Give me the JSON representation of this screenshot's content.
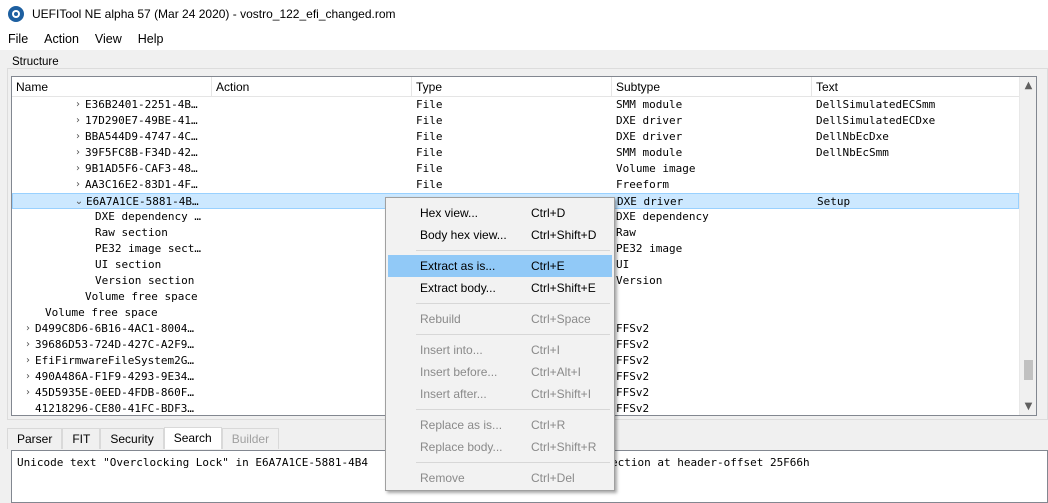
{
  "window": {
    "title": "UEFITool NE alpha 57 (Mar 24 2020) - vostro_122_efi_changed.rom"
  },
  "menubar": [
    "File",
    "Action",
    "View",
    "Help"
  ],
  "structure": {
    "label": "Structure",
    "columns": [
      "Name",
      "Action",
      "Type",
      "Subtype",
      "Text"
    ],
    "rows": [
      {
        "name": "E36B2401-2251-4B…",
        "type": "File",
        "subtype": "SMM module",
        "text": "DellSimulatedECSmm",
        "expander": "collapsed"
      },
      {
        "name": "17D290E7-49BE-41…",
        "type": "File",
        "subtype": "DXE driver",
        "text": "DellSimulatedECDxe",
        "expander": "collapsed"
      },
      {
        "name": "BBA544D9-4747-4C…",
        "type": "File",
        "subtype": "DXE driver",
        "text": "DellNbEcDxe",
        "expander": "collapsed"
      },
      {
        "name": "39F5FC8B-F34D-42…",
        "type": "File",
        "subtype": "SMM module",
        "text": "DellNbEcSmm",
        "expander": "collapsed"
      },
      {
        "name": "9B1AD5F6-CAF3-48…",
        "type": "File",
        "subtype": "Volume image",
        "text": "",
        "expander": "collapsed"
      },
      {
        "name": "AA3C16E2-83D1-4F…",
        "type": "File",
        "subtype": "Freeform",
        "text": "",
        "expander": "collapsed"
      },
      {
        "name": "E6A7A1CE-5881-4B…",
        "type": "",
        "subtype": "DXE driver",
        "text": "Setup",
        "expander": "expanded",
        "selected": true
      },
      {
        "name": "DXE dependency …",
        "type": "",
        "subtype": "DXE dependency",
        "text": "",
        "expander": "none"
      },
      {
        "name": "Raw section",
        "type": "",
        "subtype": "Raw",
        "text": "",
        "expander": "none"
      },
      {
        "name": "PE32 image sect…",
        "type": "",
        "subtype": "PE32 image",
        "text": "",
        "expander": "none"
      },
      {
        "name": "UI section",
        "type": "",
        "subtype": "UI",
        "text": "",
        "expander": "none"
      },
      {
        "name": "Version section",
        "type": "",
        "subtype": "Version",
        "text": "",
        "expander": "none"
      },
      {
        "name": "Volume free space",
        "type": "",
        "subtype": "",
        "text": "",
        "expander": "none"
      },
      {
        "name": "Volume free space",
        "type": "",
        "subtype": "",
        "text": "",
        "expander": "none"
      },
      {
        "name": "D499C8D6-6B16-4AC1-8004…",
        "type": "",
        "subtype": "FFSv2",
        "text": "",
        "expander": "collapsed"
      },
      {
        "name": "39686D53-724D-427C-A2F9…",
        "type": "",
        "subtype": "FFSv2",
        "text": "",
        "expander": "collapsed"
      },
      {
        "name": "EfiFirmwareFileSystem2G…",
        "type": "",
        "subtype": "FFSv2",
        "text": "",
        "expander": "collapsed"
      },
      {
        "name": "490A486A-F1F9-4293-9E34…",
        "type": "",
        "subtype": "FFSv2",
        "text": "",
        "expander": "collapsed"
      },
      {
        "name": "45D5935E-0EED-4FDB-860F…",
        "type": "",
        "subtype": "FFSv2",
        "text": "",
        "expander": "collapsed"
      },
      {
        "name": "41218296-CE80-41FC-BDF3…",
        "type": "",
        "subtype": "FFSv2",
        "text": "",
        "expander": "none"
      }
    ]
  },
  "bottom_tabs": [
    {
      "label": "Parser",
      "state": "normal"
    },
    {
      "label": "FIT",
      "state": "normal"
    },
    {
      "label": "Security",
      "state": "normal"
    },
    {
      "label": "Search",
      "state": "active"
    },
    {
      "label": "Builder",
      "state": "disabled"
    }
  ],
  "search_output": {
    "left_text": "Unicode text \"Overclocking Lock\" in E6A7A1CE-5881-4B4",
    "right_text": "ection at header-offset 25F66h"
  },
  "context_menu": {
    "items": [
      {
        "label": "Hex view...",
        "shortcut": "Ctrl+D",
        "enabled": true
      },
      {
        "label": "Body hex view...",
        "shortcut": "Ctrl+Shift+D",
        "enabled": true
      },
      {
        "separator": true
      },
      {
        "label": "Extract as is...",
        "shortcut": "Ctrl+E",
        "enabled": true,
        "highlighted": true
      },
      {
        "label": "Extract body...",
        "shortcut": "Ctrl+Shift+E",
        "enabled": true
      },
      {
        "separator": true
      },
      {
        "label": "Rebuild",
        "shortcut": "Ctrl+Space",
        "enabled": false
      },
      {
        "separator": true
      },
      {
        "label": "Insert into...",
        "shortcut": "Ctrl+I",
        "enabled": false
      },
      {
        "label": "Insert before...",
        "shortcut": "Ctrl+Alt+I",
        "enabled": false
      },
      {
        "label": "Insert after...",
        "shortcut": "Ctrl+Shift+I",
        "enabled": false
      },
      {
        "separator": true
      },
      {
        "label": "Replace as is...",
        "shortcut": "Ctrl+R",
        "enabled": false
      },
      {
        "label": "Replace body...",
        "shortcut": "Ctrl+Shift+R",
        "enabled": false
      },
      {
        "separator": true
      },
      {
        "label": "Remove",
        "shortcut": "Ctrl+Del",
        "enabled": false
      }
    ]
  },
  "colors": {
    "selection_bg": "#cce8ff",
    "menu_highlight": "#91c9f7",
    "app_icon": "#1d5fa0"
  },
  "icons": [
    "app-logo-icon",
    "chevron-right-icon",
    "chevron-down-icon",
    "scroll-up-icon",
    "scroll-down-icon"
  ]
}
